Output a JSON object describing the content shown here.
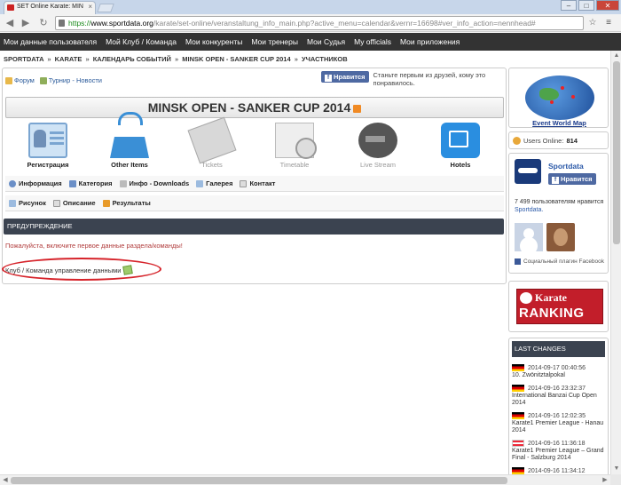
{
  "browser": {
    "tab_title": "SET Online Karate: MIN",
    "tab_close": "×",
    "url_scheme": "https://",
    "url_domain": "www.sportdata.org",
    "url_path": "/karate/set-online/veranstaltung_info_main.php?active_menu=calendar&vernr=16698#ver_info_action=nennhead#",
    "back": "◀",
    "forward": "▶",
    "reload": "↻",
    "star": "☆",
    "menu": "≡",
    "min": "–",
    "max": "□",
    "close": "✕"
  },
  "sitenav": {
    "items": [
      "Мои данные пользователя",
      "Мой Клуб / Команда",
      "Мои конкуренты",
      "Мои тренеры",
      "Мои Судья",
      "My officials",
      "Мои приложения"
    ]
  },
  "breadcrumb": {
    "items": [
      "SPORTDATA",
      "KARATE",
      "КАЛЕНДАРЬ СОБЫТИЙ",
      "MINSK OPEN - SANKER CUP 2014",
      "УЧАСТНИКОВ"
    ],
    "separator": "»"
  },
  "forum": {
    "forum_label": "Форум",
    "news_label": "Турнир - Новости"
  },
  "facebook": {
    "like_label": "Нравится",
    "like_icon": "f",
    "text": "Станьте первым из друзей, кому это понравилось."
  },
  "event": {
    "title": "MINSK OPEN - SANKER CUP 2014"
  },
  "menu_icons": [
    {
      "label": "Регистрация",
      "icon": "registration-icon",
      "active": true
    },
    {
      "label": "Other Items",
      "icon": "basket-icon",
      "active": true
    },
    {
      "label": "Tickets",
      "icon": "ticket-icon",
      "active": false
    },
    {
      "label": "Timetable",
      "icon": "timetable-icon",
      "active": false
    },
    {
      "label": "Live Stream",
      "icon": "livestream-icon",
      "active": false
    },
    {
      "label": "Hotels",
      "icon": "hotel-icon",
      "active": true
    }
  ],
  "subtabs_row1": [
    "Информация",
    "Категория",
    "Инфо - Downloads",
    "Галерея",
    "Контакт"
  ],
  "subtabs_row2": [
    "Рисунок",
    "Описание",
    "Результаты"
  ],
  "warning": {
    "header": "ПРЕДУПРЕЖДЕНИЕ",
    "message": "Пожалуйста, включите первое данные раздела/команды!",
    "team_link": "Клуб / Команда управление данными"
  },
  "sidebar": {
    "world_map_label": "Event World Map",
    "users_online_label": "Users Online:",
    "users_online_count": "814",
    "sportdata_name": "Sportdata",
    "sportdata_like": "Нравится",
    "fans_count": "7 499 пользователям нравится",
    "fans_link": "Sportdata.",
    "fb_plugin": "Социальный плагин Facebook",
    "ranking_top": "Karate",
    "ranking_bottom": "RANKING",
    "last_changes_header": "LAST CHANGES",
    "last_changes": [
      {
        "flag": "de",
        "date": "2014-09-17 00:40:56",
        "title": "10. Zwönitztalpokal"
      },
      {
        "flag": "de",
        "date": "2014-09-16 23:32:37",
        "title": "International Banzai Cup Open 2014"
      },
      {
        "flag": "de",
        "date": "2014-09-16 12:02:35",
        "title": "Karate1 Premier League - Hanau 2014"
      },
      {
        "flag": "at",
        "date": "2014-09-16 11:36:18",
        "title": "Karate1 Premier League – Grand Final - Salzburg 2014"
      },
      {
        "flag": "de",
        "date": "2014-09-16 11:34:12",
        "title": ""
      }
    ]
  },
  "colors": {
    "nav_bg": "#333333",
    "header_bar": "#3b4350",
    "warning_text": "#b03a3a",
    "annotation_circle": "#d6232a",
    "fb_blue": "#4e69a2"
  }
}
